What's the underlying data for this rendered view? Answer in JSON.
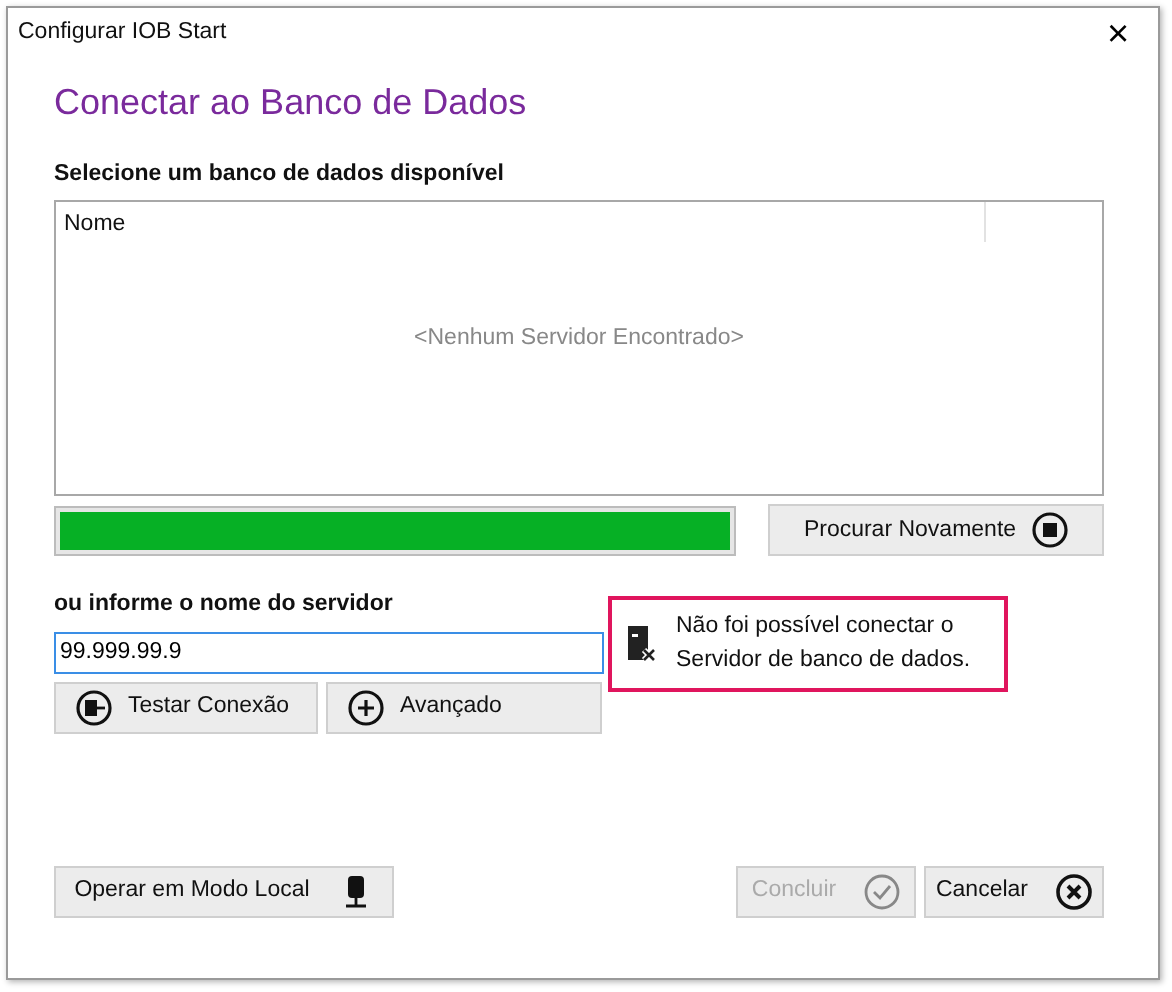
{
  "window": {
    "title": "Configurar IOB Start",
    "close": "×"
  },
  "heading": "Conectar ao Banco de Dados",
  "list_label": "Selecione um banco de dados disponível",
  "list": {
    "columns": [
      "Nome"
    ],
    "empty_text": "<Nenhum Servidor Encontrado>"
  },
  "progress": {
    "level": 1
  },
  "search_button": {
    "label": "Procurar Novamente",
    "disabled": false
  },
  "server_label": "ou informe o nome do servidor",
  "server_field": {
    "value": "99.999.99.9"
  },
  "actions": [
    {
      "label": "Testar Conexão",
      "kind": "test",
      "disabled": false
    },
    {
      "label": "Avançado",
      "kind": "plus",
      "disabled": false
    }
  ],
  "error": {
    "lines": [
      "Não foi possível conectar o",
      "Servidor de banco de dados."
    ]
  },
  "footer": [
    {
      "label": "Operar em Modo Local",
      "kind": "local",
      "disabled": false
    },
    {
      "label": "Concluir",
      "kind": "check",
      "disabled": true
    },
    {
      "label": "Cancelar",
      "kind": "cancel",
      "disabled": false
    }
  ]
}
